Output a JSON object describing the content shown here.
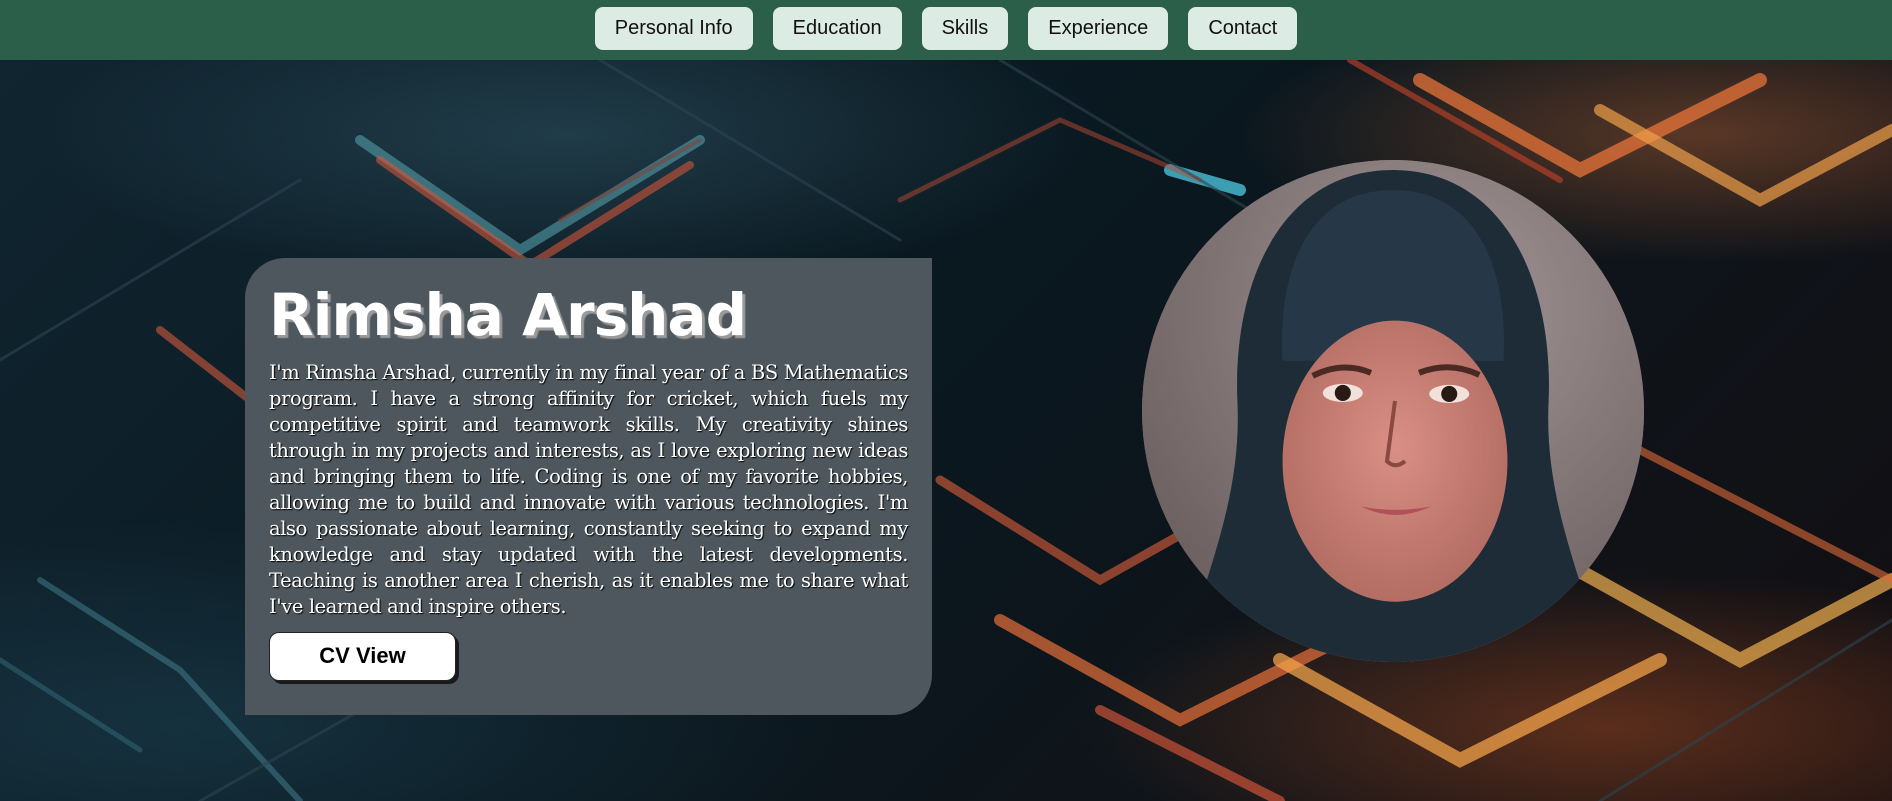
{
  "nav": {
    "items": [
      "Personal Info",
      "Education",
      "Skills",
      "Experience",
      "Contact"
    ]
  },
  "hero": {
    "name": "Rimsha Arshad",
    "bio": "I'm Rimsha Arshad, currently in my final year of a BS Mathematics program. I have a strong affinity for cricket, which fuels my competitive spirit and teamwork skills. My creativity shines through in my projects and interests, as I love exploring new ideas and bringing them to life. Coding is one of my favorite hobbies, allowing me to build and innovate with various technologies. I'm also passionate about learning, constantly seeking to expand my knowledge and stay updated with the latest developments. Teaching is another area I cherish, as it enables me to share what I've learned and inspire others.",
    "cv_button": "CV View"
  },
  "colors": {
    "navbar": "#2c5f4a",
    "nav_button": "#dcebe3",
    "card": "#4d575d",
    "accent_orange": "#e8643a"
  }
}
